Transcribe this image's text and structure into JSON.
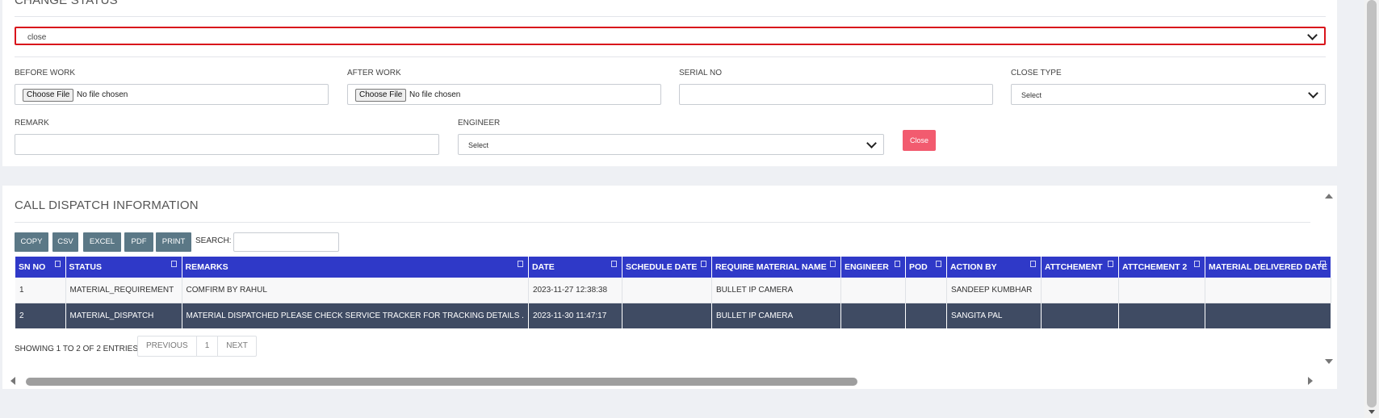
{
  "change_status": {
    "title": "CHANGE STATUS",
    "status_value": "close",
    "before_work": {
      "label": "BEFORE WORK",
      "button": "Choose File",
      "file_text": "No file chosen"
    },
    "after_work": {
      "label": "AFTER WORK",
      "button": "Choose File",
      "file_text": "No file chosen"
    },
    "serial_no": {
      "label": "SERIAL NO",
      "value": ""
    },
    "close_type": {
      "label": "CLOSE TYPE",
      "value": "Select"
    },
    "remark": {
      "label": "REMARK",
      "value": ""
    },
    "engineer": {
      "label": "ENGINEER",
      "value": "Select"
    },
    "close_button": "Close"
  },
  "dispatch": {
    "title": "CALL DISPATCH INFORMATION",
    "buttons": [
      "COPY",
      "CSV",
      "EXCEL",
      "PDF",
      "PRINT"
    ],
    "search_label": "SEARCH:",
    "search_value": "",
    "columns": [
      "SN NO",
      "STATUS",
      "REMARKS",
      "DATE",
      "SCHEDULE DATE",
      "REQUIRE MATERIAL NAME",
      "ENGINEER",
      "POD",
      "ACTION BY",
      "ATTCHEMENT",
      "ATTCHEMENT 2",
      "MATERIAL DELIVERED DATE"
    ],
    "rows": [
      [
        "1",
        "MATERIAL_REQUIREMENT",
        "COMFIRM BY RAHUL",
        "2023-11-27 12:38:38",
        "",
        "BULLET IP CAMERA",
        "",
        "",
        "SANDEEP KUMBHAR",
        "",
        "",
        ""
      ],
      [
        "2",
        "MATERIAL_DISPATCH",
        "MATERIAL DISPATCHED PLEASE CHECK SERVICE TRACKER FOR TRACKING DETAILS .",
        "2023-11-30 11:47:17",
        "",
        "BULLET IP CAMERA",
        "",
        "",
        "SANGITA PAL",
        "",
        "",
        ""
      ]
    ],
    "showing": "SHOWING 1 TO 2 OF 2 ENTRIES",
    "pagination": {
      "previous": "PREVIOUS",
      "page": "1",
      "next": "NEXT"
    }
  },
  "colors": {
    "header_blue": "#2f39c8",
    "selected_row": "#3f4b63",
    "close_button": "#f25b6f",
    "error_border": "#d9141b",
    "export_button": "#5b7886"
  }
}
